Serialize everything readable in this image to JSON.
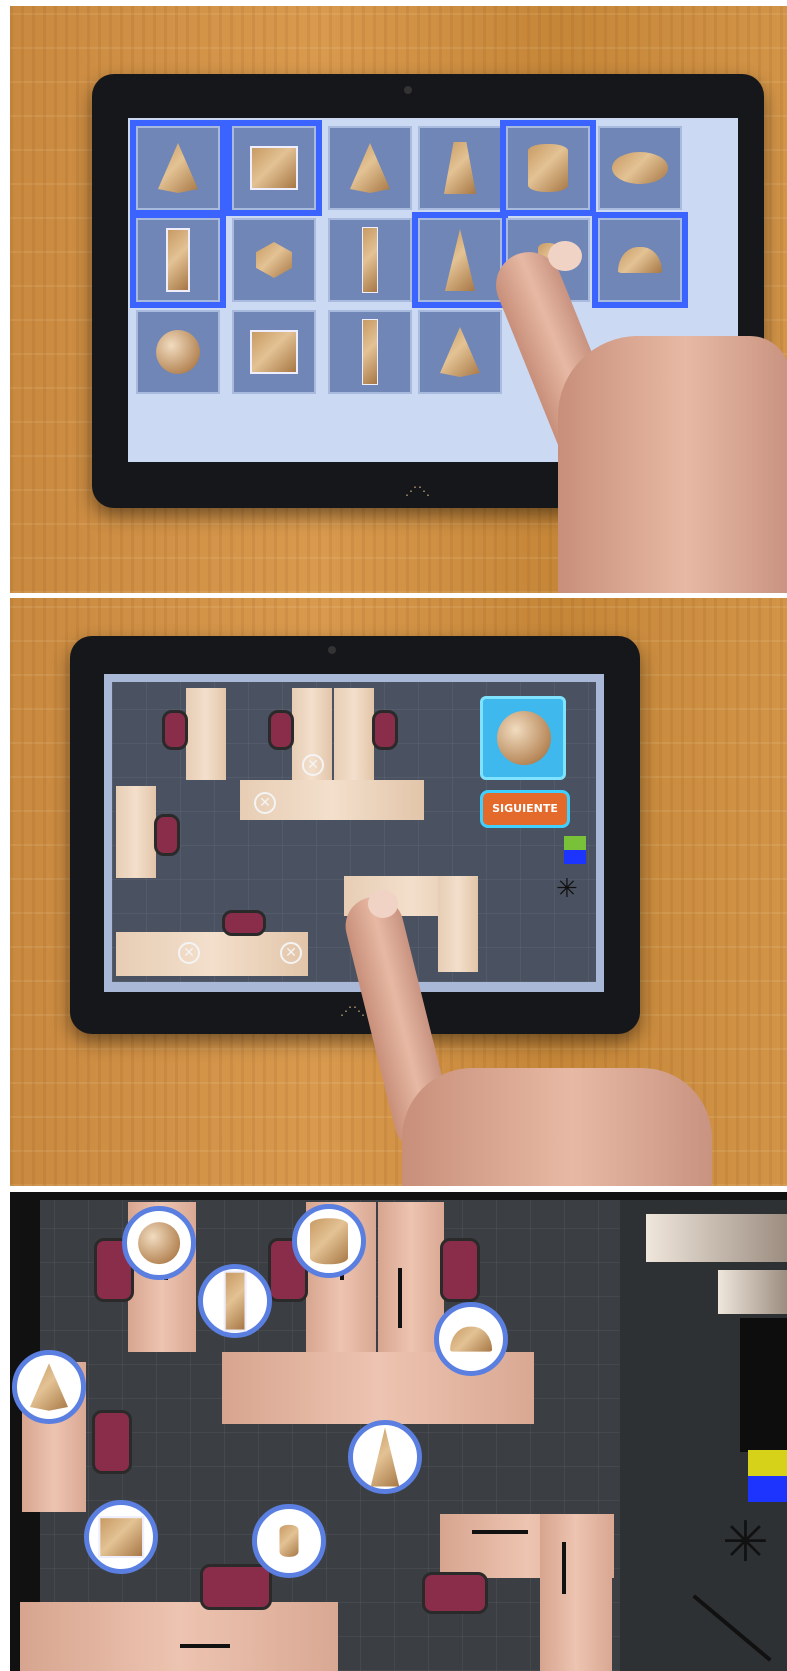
{
  "button": {
    "next_label": "SIGUIENTE"
  },
  "colors": {
    "selection": "#3b63ff",
    "button_bg": "#e46a2c",
    "button_border": "#3fd0ff",
    "bubble_border": "#5a7fe0",
    "floor": "#4a5161"
  },
  "shape_grid": {
    "rows": 3,
    "tiles": [
      {
        "shape": "cone",
        "selected": true
      },
      {
        "shape": "cube",
        "selected": true
      },
      {
        "shape": "oblique-cone",
        "selected": false
      },
      {
        "shape": "truncated-pyramid",
        "selected": false
      },
      {
        "shape": "cylinder",
        "selected": true
      },
      {
        "shape": "ellipsoid",
        "selected": false
      },
      {
        "shape": "rectangular-prism",
        "selected": true
      },
      {
        "shape": "icosahedron",
        "selected": false
      },
      {
        "shape": "tall-pentagonal-prism",
        "selected": false
      },
      {
        "shape": "tall-pyramid",
        "selected": true
      },
      {
        "shape": "small-cylinder",
        "selected": false
      },
      {
        "shape": "hemisphere",
        "selected": true
      },
      {
        "shape": "sphere",
        "selected": false
      },
      {
        "shape": "box",
        "selected": false
      },
      {
        "shape": "triangular-prism",
        "selected": false
      },
      {
        "shape": "leaning-cone",
        "selected": false
      }
    ]
  },
  "office_panel": {
    "current_object": "sphere-icon",
    "placed_markers": 4
  },
  "placement_result": {
    "bubbles": [
      "sphere",
      "cylinder",
      "rectangular-prism",
      "hemisphere",
      "cone",
      "pyramid",
      "cube",
      "small-cylinder"
    ]
  }
}
